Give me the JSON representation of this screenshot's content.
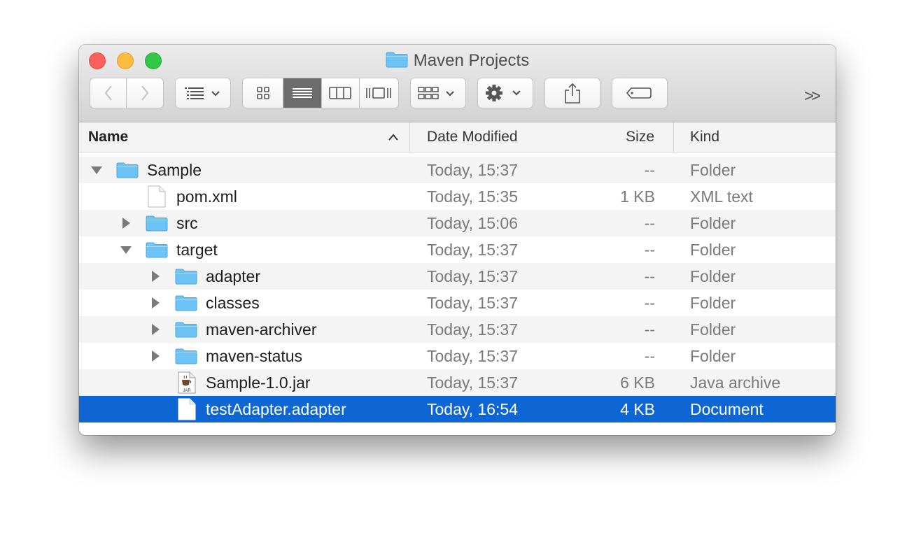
{
  "window": {
    "title": "Maven Projects"
  },
  "toolbar": {
    "overflow_label": ">>"
  },
  "columns": {
    "name": "Name",
    "date": "Date Modified",
    "size": "Size",
    "kind": "Kind"
  },
  "rows": [
    {
      "name": "Sample",
      "date": "Today, 15:37",
      "size": "--",
      "kind": "Folder"
    },
    {
      "name": "pom.xml",
      "date": "Today, 15:35",
      "size": "1 KB",
      "kind": "XML text"
    },
    {
      "name": "src",
      "date": "Today, 15:06",
      "size": "--",
      "kind": "Folder"
    },
    {
      "name": "target",
      "date": "Today, 15:37",
      "size": "--",
      "kind": "Folder"
    },
    {
      "name": "adapter",
      "date": "Today, 15:37",
      "size": "--",
      "kind": "Folder"
    },
    {
      "name": "classes",
      "date": "Today, 15:37",
      "size": "--",
      "kind": "Folder"
    },
    {
      "name": "maven-archiver",
      "date": "Today, 15:37",
      "size": "--",
      "kind": "Folder"
    },
    {
      "name": "maven-status",
      "date": "Today, 15:37",
      "size": "--",
      "kind": "Folder"
    },
    {
      "name": "Sample-1.0.jar",
      "date": "Today, 15:37",
      "size": "6 KB",
      "kind": "Java archive",
      "icon_label": "JAR"
    },
    {
      "name": "testAdapter.adapter",
      "date": "Today, 16:54",
      "size": "4 KB",
      "kind": "Document"
    }
  ],
  "colors": {
    "selection": "#0e66d4",
    "folder": "#6cc3f5"
  }
}
